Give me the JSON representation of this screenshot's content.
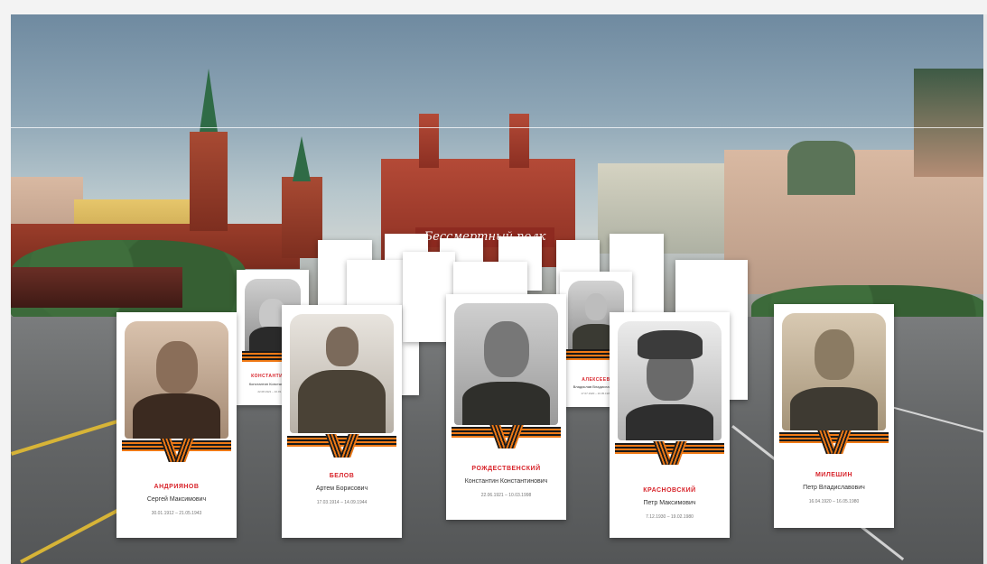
{
  "banner": {
    "text": "Бессмертный полк"
  },
  "front_cards": [
    {
      "surname": "АНДРИЯНОВ",
      "name": "Сергей Максимович",
      "dates": "30.01.1912 – 21.05.1943"
    },
    {
      "surname": "БЕЛОВ",
      "name": "Артем Борисович",
      "dates": "17.03.1914 – 14.09.1944"
    },
    {
      "surname": "РОЖДЕСТВЕНСКИЙ",
      "name": "Константин Константинович",
      "dates": "22.06.1921 – 10.03.1998"
    },
    {
      "surname": "КРАСНОВСКИЙ",
      "name": "Петр Максимович",
      "dates": "7.12.1930 – 19.02.1980"
    },
    {
      "surname": "МИЛЕШИН",
      "name": "Петр Владиславович",
      "dates": "16.04.1920 – 16.05.1980"
    }
  ],
  "back_cards": [
    {
      "surname": "КОНСТАНТИНОВ",
      "name": "Константин Константинович",
      "dates": "22.08.1921 – 10.03.1998"
    },
    {
      "surname": "АЛЕКСЕЕВ",
      "name": "Владислав Владиславович",
      "dates": "17.07.1920 – 16.05.1980"
    }
  ]
}
